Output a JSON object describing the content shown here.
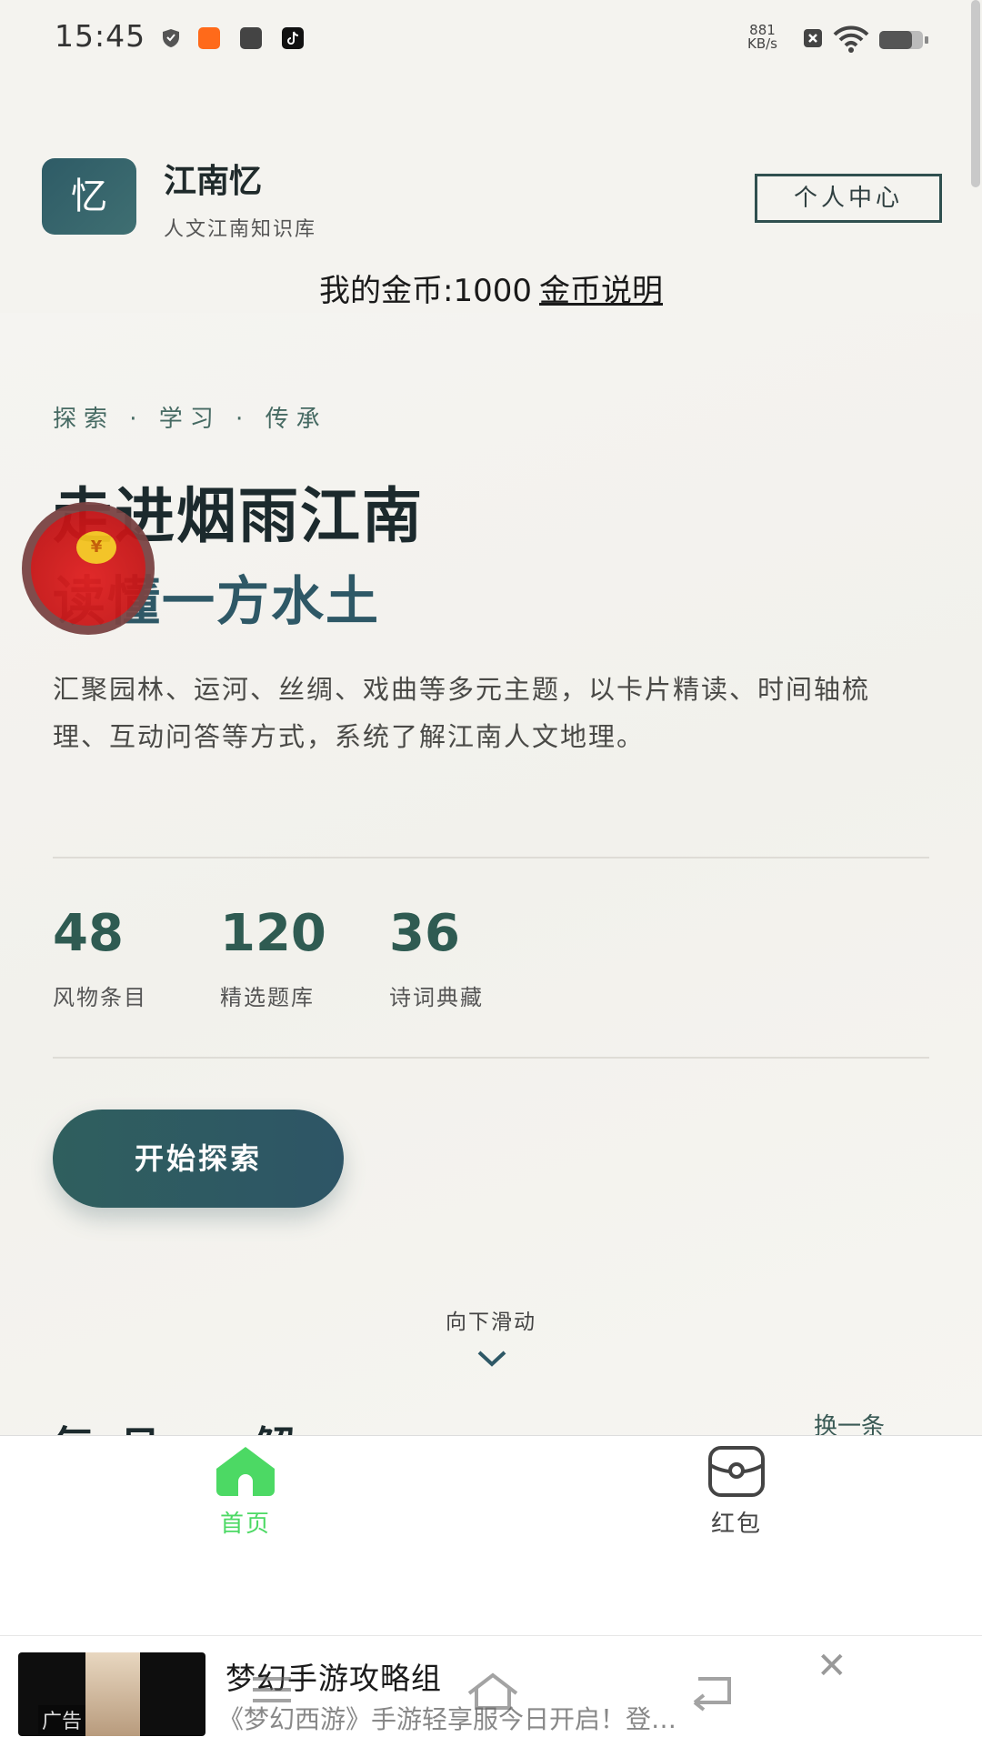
{
  "status_bar": {
    "time": "15:45",
    "net_speed_value": "881",
    "net_speed_unit": "KB/s",
    "icons": [
      "shield-icon",
      "app-kuaishou-icon",
      "message-icon",
      "tiktok-icon",
      "sim-off-icon",
      "wifi-icon",
      "battery-icon"
    ]
  },
  "header": {
    "logo_char": "忆",
    "app_name": "江南忆",
    "app_subtitle": "人文江南知识库",
    "profile_button": "个人中心",
    "coins_label": "我的金币:1000",
    "coins_link": "金币说明"
  },
  "hero": {
    "tagline": "探索 · 学习 · 传承",
    "title_line1": "走进烟雨江南",
    "title_line2": "读懂一方水土",
    "description": "汇聚园林、运河、丝绸、戏曲等多元主题，以卡片精读、时间轴梳理、互动问答等方式，系统了解江南人文地理。",
    "stats": [
      {
        "value": "48",
        "label": "风物条目"
      },
      {
        "value": "120",
        "label": "精选题库"
      },
      {
        "value": "36",
        "label": "诗词典藏"
      }
    ],
    "start_button": "开始探索",
    "scroll_hint": "向下滑动",
    "next_section_title": "每日一解",
    "next_section_action": "换一条"
  },
  "bottom_nav": {
    "items": [
      {
        "label": "首页",
        "icon": "home-icon",
        "active": true
      },
      {
        "label": "红包",
        "icon": "red-packet-icon",
        "active": false
      }
    ],
    "active_color": "#4cd964"
  },
  "ad": {
    "tag": "广告",
    "title": "梦幻手游攻略组",
    "description": "《梦幻西游》手游轻享服今日开启！登…"
  },
  "colors": {
    "accent": "#2e5866",
    "stat_number": "#2f5b52",
    "red_packet": "#d81e1e"
  }
}
